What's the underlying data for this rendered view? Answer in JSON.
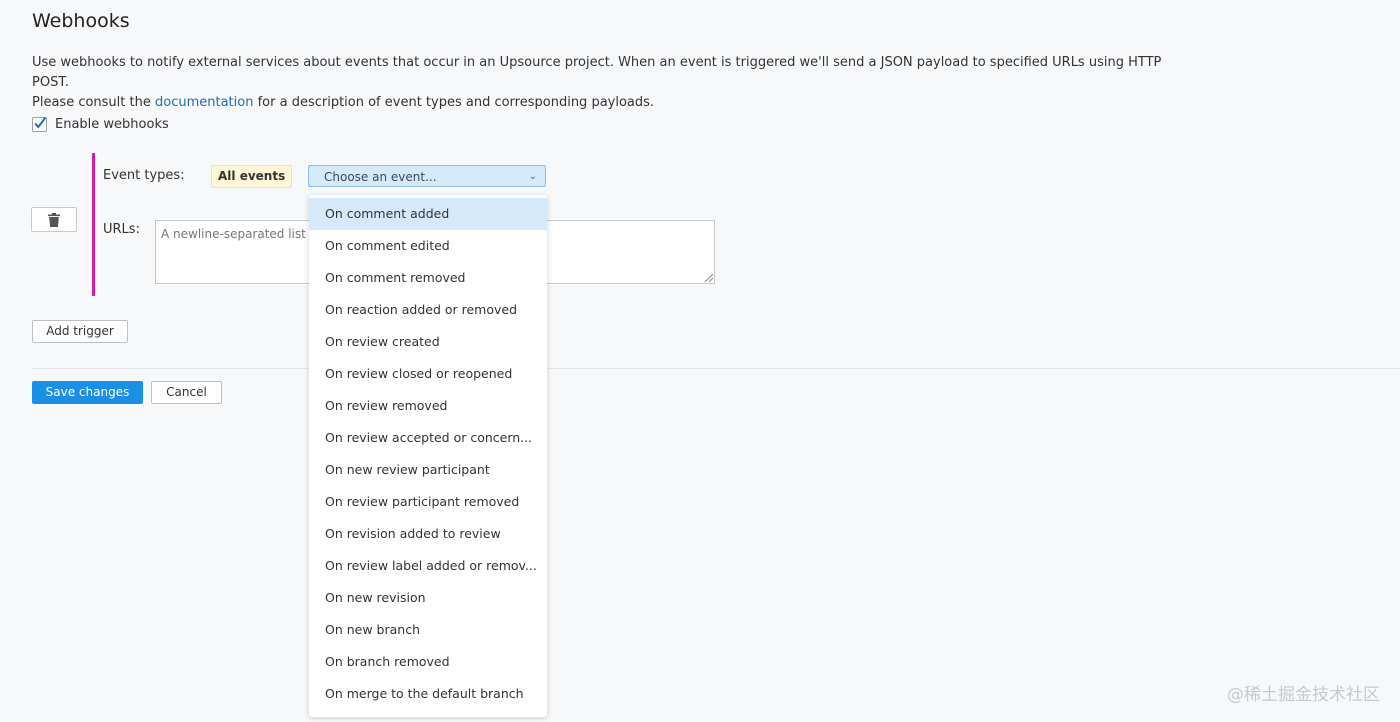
{
  "page": {
    "title": "Webhooks",
    "description_line1": "Use webhooks to notify external services about events that occur in an Upsource project. When an event is triggered we'll send a JSON payload to specified URLs using HTTP POST.",
    "description_line2_prefix": "Please consult the ",
    "description_link": "documentation",
    "description_line2_suffix": " for a description of event types and corresponding payloads."
  },
  "enable": {
    "label": "Enable webhooks",
    "checked": true
  },
  "trigger": {
    "event_types_label": "Event types:",
    "all_events_badge": "All events",
    "select_placeholder": "Choose an event...",
    "urls_label": "URLs:",
    "urls_placeholder": "A newline-separated list of URLs"
  },
  "dropdown": {
    "items": [
      "On comment added",
      "On comment edited",
      "On comment removed",
      "On reaction added or removed",
      "On review created",
      "On review closed or reopened",
      "On review removed",
      "On review accepted or concern...",
      "On new review participant",
      "On review participant removed",
      "On revision added to review",
      "On review label added or remov...",
      "On new revision",
      "On new branch",
      "On branch removed",
      "On merge to the default branch"
    ],
    "highlighted_index": 0
  },
  "buttons": {
    "add_trigger": "Add trigger",
    "save": "Save changes",
    "cancel": "Cancel"
  },
  "colors": {
    "accent": "#1a8fe6",
    "trigger_bar": "#d81bb0",
    "badge_bg": "#fdf7d8",
    "select_bg": "#d6e9fb"
  },
  "watermark": "@稀土掘金技术社区"
}
